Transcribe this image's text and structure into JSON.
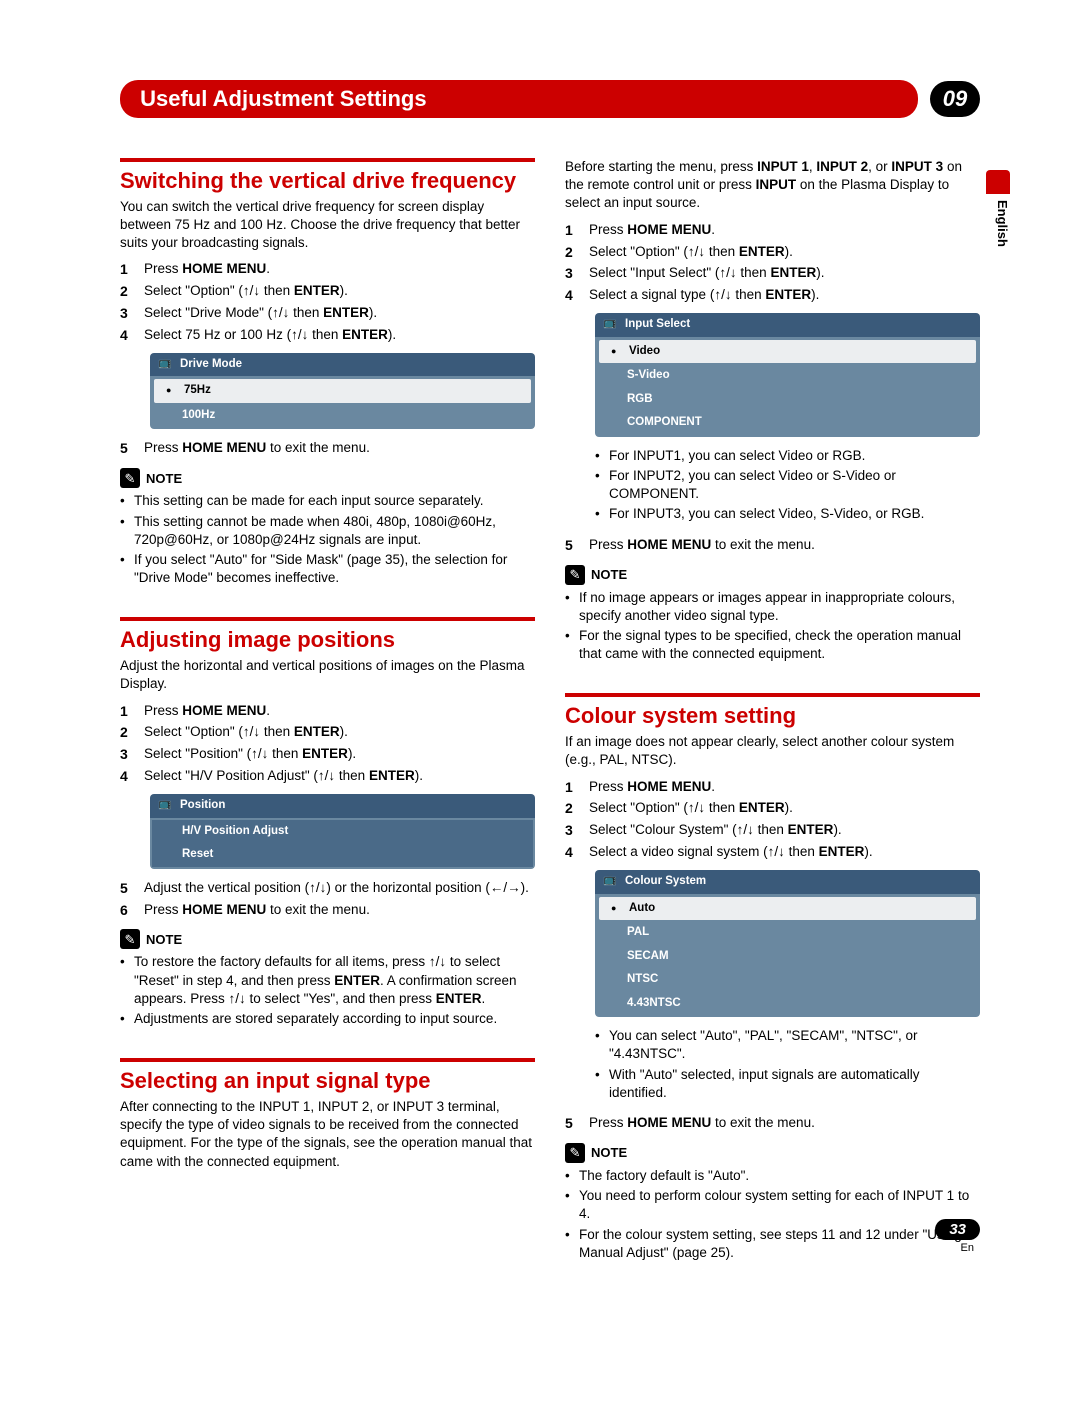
{
  "header": {
    "title": "Useful Adjustment Settings",
    "chapter": "09"
  },
  "lang_tab": "English",
  "footer": {
    "page": "33",
    "lang": "En"
  },
  "arrows": {
    "up": "↑",
    "down": "↓",
    "left": "←",
    "right": "→",
    "updown": "↑/↓",
    "leftright": "←/→"
  },
  "left": {
    "sec1": {
      "title": "Switching the vertical drive frequency",
      "intro": "You can switch the vertical drive frequency for screen display between 75 Hz and 100 Hz. Choose the drive frequency that better suits your broadcasting signals.",
      "steps": [
        {
          "n": "1",
          "pre": "Press ",
          "b": "HOME MENU",
          "post": "."
        },
        {
          "n": "2",
          "pre": "Select \"Option\" (",
          "arr": true,
          "mid": " then ",
          "b": "ENTER",
          "post": ")."
        },
        {
          "n": "3",
          "pre": "Select \"Drive Mode\" (",
          "arr": true,
          "mid": " then ",
          "b": "ENTER",
          "post": ")."
        },
        {
          "n": "4",
          "pre": "Select 75 Hz or 100 Hz (",
          "arr": true,
          "mid": " then ",
          "b": "ENTER",
          "post": ")."
        }
      ],
      "menu": {
        "title": "Drive Mode",
        "items": [
          {
            "label": "75Hz",
            "sel": true
          },
          {
            "label": "100Hz"
          }
        ]
      },
      "step5": {
        "n": "5",
        "pre": "Press ",
        "b": "HOME MENU",
        "post": " to exit the menu."
      },
      "note_label": "NOTE",
      "notes": [
        "This setting can be made for each input source separately.",
        "This setting cannot be made when 480i, 480p, 1080i@60Hz, 720p@60Hz, or 1080p@24Hz signals are input.",
        "If you select \"Auto\" for \"Side Mask\" (page 35), the selection for \"Drive Mode\" becomes ineffective."
      ]
    },
    "sec2": {
      "title": "Adjusting image positions",
      "intro": "Adjust the horizontal and vertical positions of images on the Plasma Display.",
      "steps": [
        {
          "n": "1",
          "pre": "Press ",
          "b": "HOME MENU",
          "post": "."
        },
        {
          "n": "2",
          "pre": "Select \"Option\" (",
          "arr": true,
          "mid": " then ",
          "b": "ENTER",
          "post": ")."
        },
        {
          "n": "3",
          "pre": "Select \"Position\" (",
          "arr": true,
          "mid": " then ",
          "b": "ENTER",
          "post": ")."
        },
        {
          "n": "4",
          "pre": "Select \"H/V Position Adjust\" (",
          "arr": true,
          "mid": " then ",
          "b": "ENTER",
          "post": ")."
        }
      ],
      "menu": {
        "title": "Position",
        "items": [
          {
            "label": "H/V Position Adjust",
            "dark": true
          },
          {
            "label": "Reset",
            "dark": true
          }
        ]
      },
      "step5": {
        "n": "5",
        "t": "Adjust the vertical position (↑/↓) or the horizontal position (←/→)."
      },
      "step6": {
        "n": "6",
        "pre": "Press ",
        "b": "HOME MENU",
        "post": " to exit the menu."
      },
      "note_label": "NOTE",
      "notes_html": [
        "To restore the factory defaults for all items, press ↑/↓ to select \"Reset\" in step 4, and then press <b>ENTER</b>. A confirmation screen appears. Press ↑/↓ to select \"Yes\", and then press <b>ENTER</b>.",
        "Adjustments are stored separately according to input source."
      ]
    },
    "sec3": {
      "title": "Selecting an input signal type",
      "intro": "After connecting to the INPUT 1, INPUT 2, or INPUT 3 terminal, specify the type of video signals to be received from the connected equipment. For the type of the signals, see the operation manual that came with the connected equipment."
    }
  },
  "right": {
    "pre_intro_html": "Before starting the menu, press <b>INPUT 1</b>, <b>INPUT 2</b>, or <b>INPUT 3</b> on the remote control unit or press <b>INPUT</b> on the Plasma Display to select an input source.",
    "steps1": [
      {
        "n": "1",
        "pre": "Press ",
        "b": "HOME MENU",
        "post": "."
      },
      {
        "n": "2",
        "pre": "Select \"Option\" (",
        "arr": true,
        "mid": " then ",
        "b": "ENTER",
        "post": ")."
      },
      {
        "n": "3",
        "pre": "Select \"Input Select\" (",
        "arr": true,
        "mid": " then ",
        "b": "ENTER",
        "post": ")."
      },
      {
        "n": "4",
        "pre": "Select a signal type (",
        "arr": true,
        "mid": " then ",
        "b": "ENTER",
        "post": ")."
      }
    ],
    "menu1": {
      "title": "Input Select",
      "items": [
        {
          "label": "Video",
          "sel": true
        },
        {
          "label": "S-Video"
        },
        {
          "label": "RGB"
        },
        {
          "label": "COMPONENT"
        }
      ]
    },
    "subbul1": [
      "For INPUT1, you can select Video or RGB.",
      "For INPUT2, you can select Video or S-Video or COMPONENT.",
      "For INPUT3, you can select Video, S-Video, or RGB."
    ],
    "step5a": {
      "n": "5",
      "pre": "Press ",
      "b": "HOME MENU",
      "post": " to exit the menu."
    },
    "note_label": "NOTE",
    "notes1": [
      "If no image appears or images appear in inappropriate colours, specify another video signal type.",
      "For the signal types to be specified, check the operation manual that came with the connected equipment."
    ],
    "sec2": {
      "title": "Colour system setting",
      "intro": "If an image does not appear clearly, select another colour system (e.g., PAL, NTSC).",
      "steps": [
        {
          "n": "1",
          "pre": "Press ",
          "b": "HOME MENU",
          "post": "."
        },
        {
          "n": "2",
          "pre": "Select \"Option\" (",
          "arr": true,
          "mid": " then ",
          "b": "ENTER",
          "post": ")."
        },
        {
          "n": "3",
          "pre": "Select \"Colour System\" (",
          "arr": true,
          "mid": " then ",
          "b": "ENTER",
          "post": ")."
        },
        {
          "n": "4",
          "pre": "Select a video signal system (",
          "arr": true,
          "mid": " then ",
          "b": "ENTER",
          "post": ")."
        }
      ],
      "menu": {
        "title": "Colour System",
        "items": [
          {
            "label": "Auto",
            "sel": true
          },
          {
            "label": "PAL"
          },
          {
            "label": "SECAM"
          },
          {
            "label": "NTSC"
          },
          {
            "label": "4.43NTSC"
          }
        ]
      },
      "subbul": [
        "You can select \"Auto\", \"PAL\", \"SECAM\", \"NTSC\", or \"4.43NTSC\".",
        "With \"Auto\" selected, input signals are automatically identified."
      ],
      "step5": {
        "n": "5",
        "pre": "Press ",
        "b": "HOME MENU",
        "post": " to exit the menu."
      },
      "note_label": "NOTE",
      "notes": [
        "The factory default is \"Auto\".",
        "You need to perform colour system setting for each of INPUT 1 to 4.",
        "For the colour system setting, see steps 11 and 12 under \"Using Manual Adjust\" (page 25)."
      ]
    }
  }
}
